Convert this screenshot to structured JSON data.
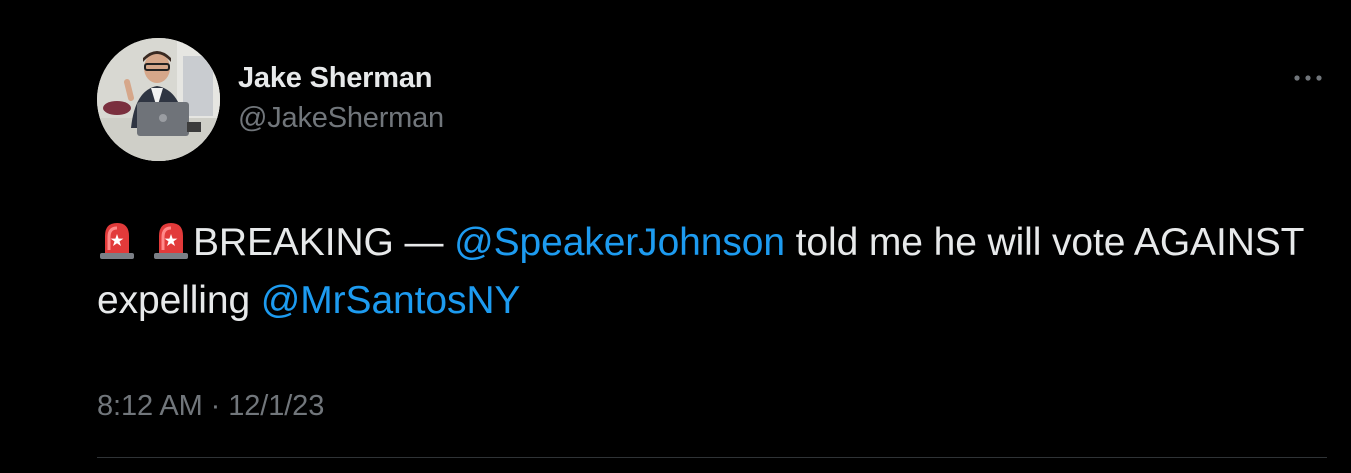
{
  "author": {
    "display_name": "Jake Sherman",
    "handle": "@JakeSherman"
  },
  "tweet": {
    "emoji_1": "siren-emoji",
    "emoji_2": "siren-emoji",
    "text_part1": "BREAKING — ",
    "mention_1": "@SpeakerJohnson",
    "text_part2": " told me he will vote AGAINST expelling ",
    "mention_2": "@MrSantosNY"
  },
  "meta": {
    "time": "8:12 AM",
    "separator": " · ",
    "date": "12/1/23"
  },
  "icons": {
    "more": "more-horizontal-icon"
  },
  "colors": {
    "background": "#000000",
    "primary_text": "#e7e9ea",
    "secondary_text": "#71767b",
    "link": "#1d9bf0",
    "divider": "#2f3336"
  }
}
